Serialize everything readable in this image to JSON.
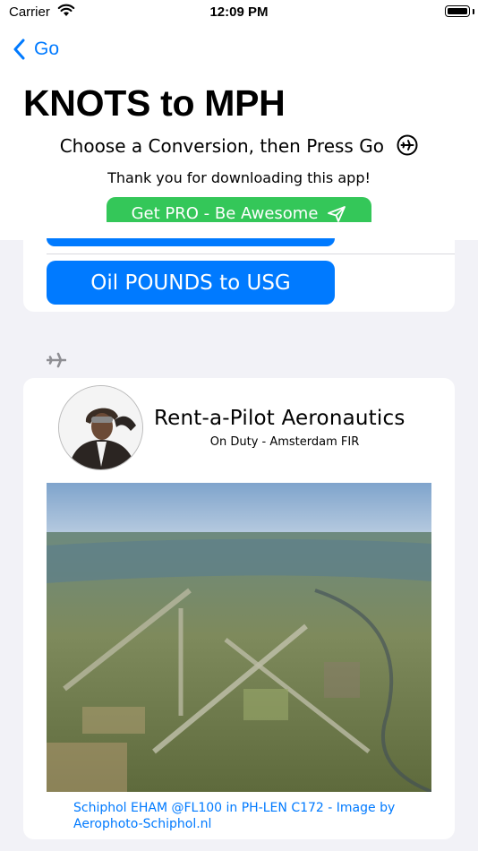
{
  "status_bar": {
    "carrier": "Carrier",
    "time": "12:09 PM"
  },
  "nav": {
    "back_label": "Go",
    "title": "KNOTS to MPH"
  },
  "header": {
    "instruction": "Choose a Conversion, then Press Go",
    "thanks": "Thank you for downloading this app!",
    "pro_button_label": "Get PRO - Be Awesome"
  },
  "conversions": {
    "oil_button_label": "Oil POUNDS to USG"
  },
  "pilot_card": {
    "company": "Rent-a-Pilot Aeronautics",
    "status": "On Duty - Amsterdam FIR",
    "caption": "Schiphol EHAM @FL100 in PH-LEN C172 - Image by Aerophoto-Schiphol.nl"
  },
  "colors": {
    "accent": "#007aff",
    "pro_green": "#34c759",
    "background": "#f2f2f7"
  }
}
